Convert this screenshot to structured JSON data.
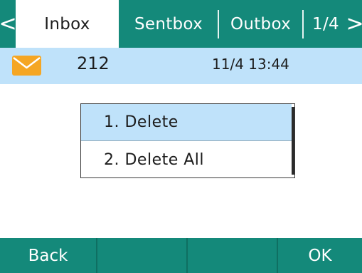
{
  "tabs": {
    "prev_arrow": "<",
    "next_arrow": ">",
    "items": [
      {
        "label": "Inbox",
        "active": true
      },
      {
        "label": "Sentbox",
        "active": false
      },
      {
        "label": "Outbox",
        "active": false
      }
    ],
    "page_indicator": "1/4"
  },
  "message": {
    "icon": "envelope-icon",
    "sender": "212",
    "time": "11/4 13:44"
  },
  "menu": {
    "items": [
      {
        "label": "1. Delete",
        "selected": true
      },
      {
        "label": "2. Delete All",
        "selected": false
      }
    ]
  },
  "softkeys": {
    "left": "Back",
    "mid1": "",
    "mid2": "",
    "right": "OK"
  },
  "colors": {
    "accent": "#14897a",
    "highlight": "#bfe2fa",
    "envelope": "#f5a623"
  }
}
